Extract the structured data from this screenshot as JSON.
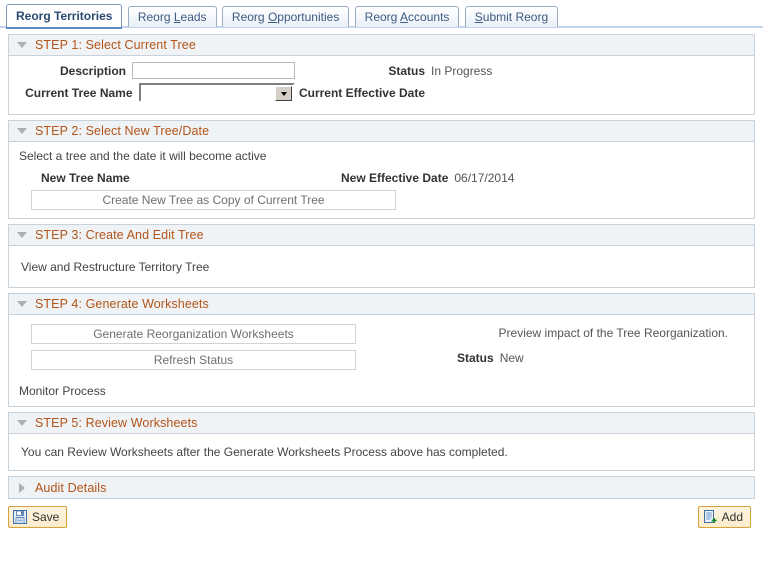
{
  "tabs": [
    {
      "label": "Reorg Territories",
      "accel": "",
      "active": true
    },
    {
      "label": "Reorg Leads",
      "accel": "L",
      "active": false
    },
    {
      "label": "Reorg Opportunities",
      "accel": "O",
      "active": false
    },
    {
      "label": "Reorg Accounts",
      "accel": "A",
      "active": false
    },
    {
      "label": "Submit Reorg",
      "accel": "S",
      "active": false
    }
  ],
  "step1": {
    "title": "STEP 1: Select Current Tree",
    "description_label": "Description",
    "description_value": "",
    "description_placeholder": "",
    "tree_name_label": "Current Tree Name",
    "tree_name_value": "",
    "status_label": "Status",
    "status_value": "In Progress",
    "effective_date_label": "Current Effective Date",
    "effective_date_value": ""
  },
  "step2": {
    "title": "STEP 2: Select New Tree/Date",
    "instruction": "Select a tree and the date it will become active",
    "new_tree_name_label": "New Tree Name",
    "new_effective_date_label": "New Effective Date",
    "new_effective_date_value": "06/17/2014",
    "create_copy_button": "Create New Tree as Copy of Current Tree"
  },
  "step3": {
    "title": "STEP 3: Create And Edit Tree",
    "link": "View and Restructure Territory Tree"
  },
  "step4": {
    "title": "STEP 4: Generate Worksheets",
    "generate_button": "Generate Reorganization Worksheets",
    "refresh_button": "Refresh Status",
    "preview_text": "Preview impact of the Tree Reorganization.",
    "status_label": "Status",
    "status_value": "New",
    "monitor_link": "Monitor Process"
  },
  "step5": {
    "title": "STEP 5: Review Worksheets",
    "text": "You can Review Worksheets after the Generate Worksheets Process above has completed."
  },
  "audit": {
    "title": "Audit Details"
  },
  "footer": {
    "save_label": "Save",
    "add_label": "Add"
  },
  "colors": {
    "section_title": "#b35419",
    "tab_active_text": "#2b4a72",
    "button_border": "#d6a23c"
  }
}
